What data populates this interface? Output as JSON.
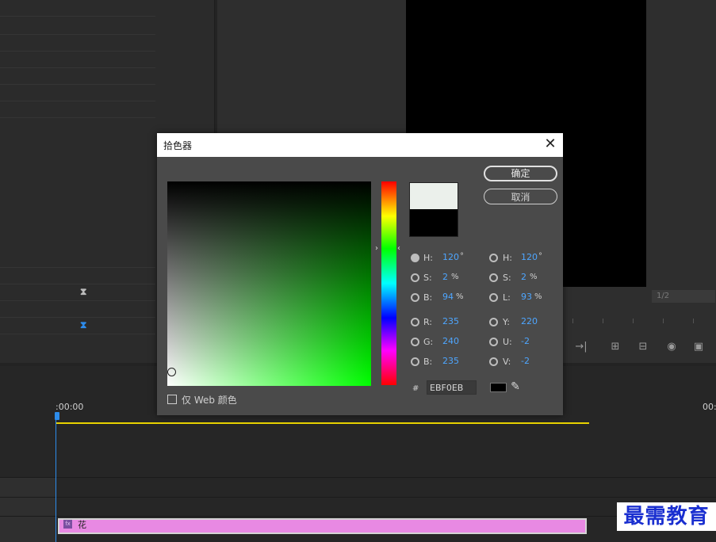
{
  "background": {
    "monitor_fraction": "1/2",
    "timecode_left": ":00:00",
    "timecode_right": "00:",
    "clip_label": "花",
    "clip_fx": "fx",
    "clip_color": "#e889e3",
    "playhead_color": "#2d8ceb",
    "workarea_color": "#e8d200",
    "watermark": "最需教育"
  },
  "dialog": {
    "title": "拾色器",
    "close_glyph": "✕",
    "ok_label": "确定",
    "cancel_label": "取消",
    "hue_left_glyph": "›",
    "hue_right_glyph": "‹",
    "new_color": "#ebf0eb",
    "old_color": "#000000",
    "hsb": {
      "h": {
        "label": "H:",
        "value": "120",
        "unit": "°",
        "selected": true
      },
      "s": {
        "label": "S:",
        "value": "2",
        "unit": "%"
      },
      "b": {
        "label": "B:",
        "value": "94",
        "unit": "%"
      }
    },
    "hsl": {
      "h": {
        "label": "H:",
        "value": "120",
        "unit": "°"
      },
      "s": {
        "label": "S:",
        "value": "2",
        "unit": "%"
      },
      "l": {
        "label": "L:",
        "value": "93",
        "unit": "%"
      }
    },
    "rgb": {
      "r": {
        "label": "R:",
        "value": "235"
      },
      "g": {
        "label": "G:",
        "value": "240"
      },
      "b": {
        "label": "B:",
        "value": "235"
      }
    },
    "yuv": {
      "y": {
        "label": "Y:",
        "value": "220"
      },
      "u": {
        "label": "U:",
        "value": "-2"
      },
      "v": {
        "label": "V:",
        "value": "-2"
      }
    },
    "hex_label": "#",
    "hex_value": "EBF0EB",
    "web_only_label": "仅 Web 颜色",
    "eyedropper_glyph": "✎"
  }
}
